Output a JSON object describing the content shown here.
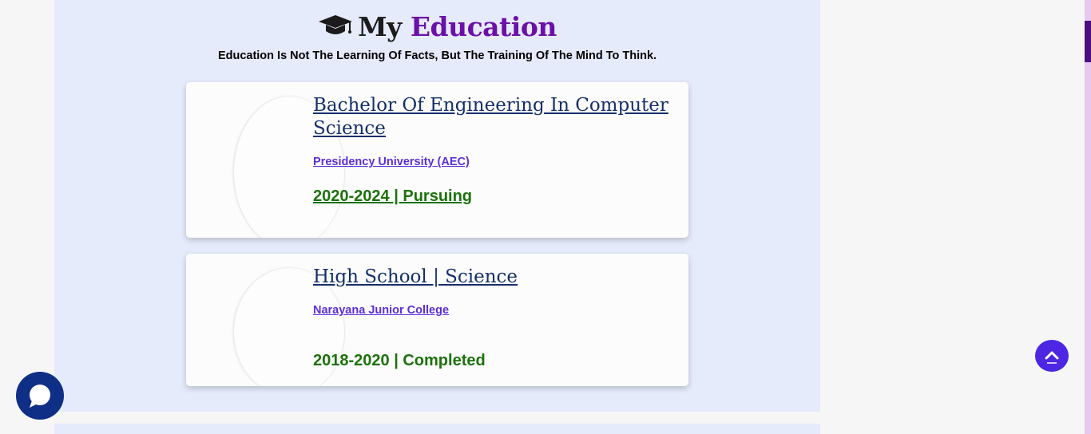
{
  "section": {
    "title_prefix": "My",
    "title_accent": "Education",
    "subtitle": "Education Is Not The Learning Of Facts, But The Training Of The Mind To Think.",
    "icon": "graduation-cap-icon"
  },
  "education": [
    {
      "degree": "Bachelor Of Engineering In Computer Science",
      "institution": "Presidency University (AEC)",
      "years": "2020-2024 | Pursuing"
    },
    {
      "degree": "High School | Science",
      "institution": "Narayana Junior College",
      "years": "2018-2020 | Completed"
    }
  ],
  "widgets": {
    "chat_icon": "chat-bubble-icon",
    "scroll_top_icon": "chevron-up-icon"
  },
  "colors": {
    "accent": "#6b10a8",
    "section_bg": "#e5ebfb",
    "degree": "#14306b",
    "institution": "#5b2fd9",
    "years": "#1b7209",
    "chat": "#0f2f86",
    "scroll_top": "#4c26e3"
  }
}
